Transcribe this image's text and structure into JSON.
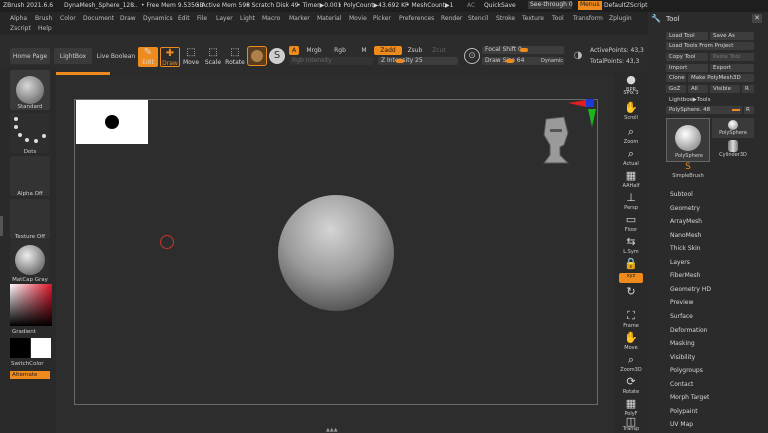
{
  "title_bar": {
    "app": "ZBrush 2021.6.6",
    "project": "DynaMesh_Sphere_128",
    "dots": "...",
    "free_mem": "• Free Mem 9.535GB",
    "active_mem": "• Active Mem 598",
    "scratch_disk": "• Scratch Disk 49",
    "timer": "• Timer▶0.001",
    "polycount": "• PolyCount▶43.692 KP",
    "meshcount": "• MeshCount▶1",
    "ac": "AC",
    "quicksave": "QuickSave",
    "see_through": "See-through 0",
    "menus": "Menus",
    "default_zscript": "DefaultZScript"
  },
  "menu": {
    "row1": [
      "Alpha",
      "Brush",
      "Color",
      "Document",
      "Draw",
      "Dynamics",
      "Edit",
      "File",
      "Layer",
      "Light",
      "Macro",
      "Marker",
      "Material",
      "Movie",
      "Picker",
      "Preferences",
      "Render",
      "Stencil",
      "Stroke",
      "Texture",
      "Tool",
      "Transform",
      "Zplugin"
    ],
    "row2": [
      "Zscript",
      "Help"
    ]
  },
  "toolbar": {
    "home_page": "Home Page",
    "lightbox": "LightBox",
    "live_boolean": "Live Boolean",
    "edit": "Edit",
    "draw": "Draw",
    "move": "Move",
    "scale": "Scale",
    "rotate": "Rotate",
    "a": "A",
    "mrgb": "Mrgb",
    "rgb": "Rgb",
    "m": "M",
    "zadd": "Zadd",
    "zsub": "Zsub",
    "zcut": "Zcut",
    "rgb_intensity": "Rgb Intensity",
    "z_intensity": "Z Intensity 25",
    "z_intensity_value": 0.25,
    "focal_shift": "Focal Shift 0",
    "draw_size": "Draw Size 64",
    "dynamic": "Dynamic",
    "active_points": "ActivePoints: 43,3",
    "total_points": "TotalPoints: 43,3"
  },
  "left_panel": {
    "standard": "Standard",
    "dots": "Dots",
    "alpha_off": "Alpha Off",
    "texture_off": "Texture Off",
    "matcap_gray": "MatCap Gray",
    "gradient": "Gradient",
    "switch_color": "SwitchColor",
    "alternate": "Alternate"
  },
  "right_strip": {
    "bpr": "BPR",
    "spix": "SPix 3",
    "scroll": "Scroll",
    "zoom": "Zoom",
    "actual": "Actual",
    "aahalf": "AAHalf",
    "persp": "Persp",
    "floor": "Floor",
    "lsym": "L.Sym",
    "xyz": "xyz",
    "frame": "Frame",
    "move": "Move",
    "zoom3d": "Zoom3D",
    "rotate": "Rotate",
    "polyf": "PolyF",
    "transp": "Transp"
  },
  "tool_panel": {
    "title": "Tool",
    "load_tool": "Load Tool",
    "save_as": "Save As",
    "load_from_project": "Load Tools From Project",
    "copy_tool": "Copy Tool",
    "paste_tool": "Paste Tool",
    "import": "Import",
    "export": "Export",
    "clone": "Clone",
    "make_polymesh": "Make PolyMesh3D",
    "goz": "GoZ",
    "all": "All",
    "visible": "Visible",
    "r": "R",
    "lightbox_tools": "Lightbox▶Tools",
    "polysphere_slider": "PolySphere. 48",
    "polysphere": "PolySphere",
    "polysphere2": "PolySphere",
    "cylinder3d": "Cylinder3D",
    "simplebrush": "SimpleBrush",
    "subpalettes": [
      "Subtool",
      "Geometry",
      "ArrayMesh",
      "NanoMesh",
      "Thick Skin",
      "Layers",
      "FiberMesh",
      "Geometry HD",
      "Preview",
      "Surface",
      "Deformation",
      "Masking",
      "Visibility",
      "Polygroups",
      "Contact",
      "Morph Target",
      "Polypaint",
      "UV Map"
    ]
  },
  "colors": {
    "accent": "#ef8a1c",
    "background": "#2a2a2a",
    "viewport": "#2d2d2d"
  }
}
